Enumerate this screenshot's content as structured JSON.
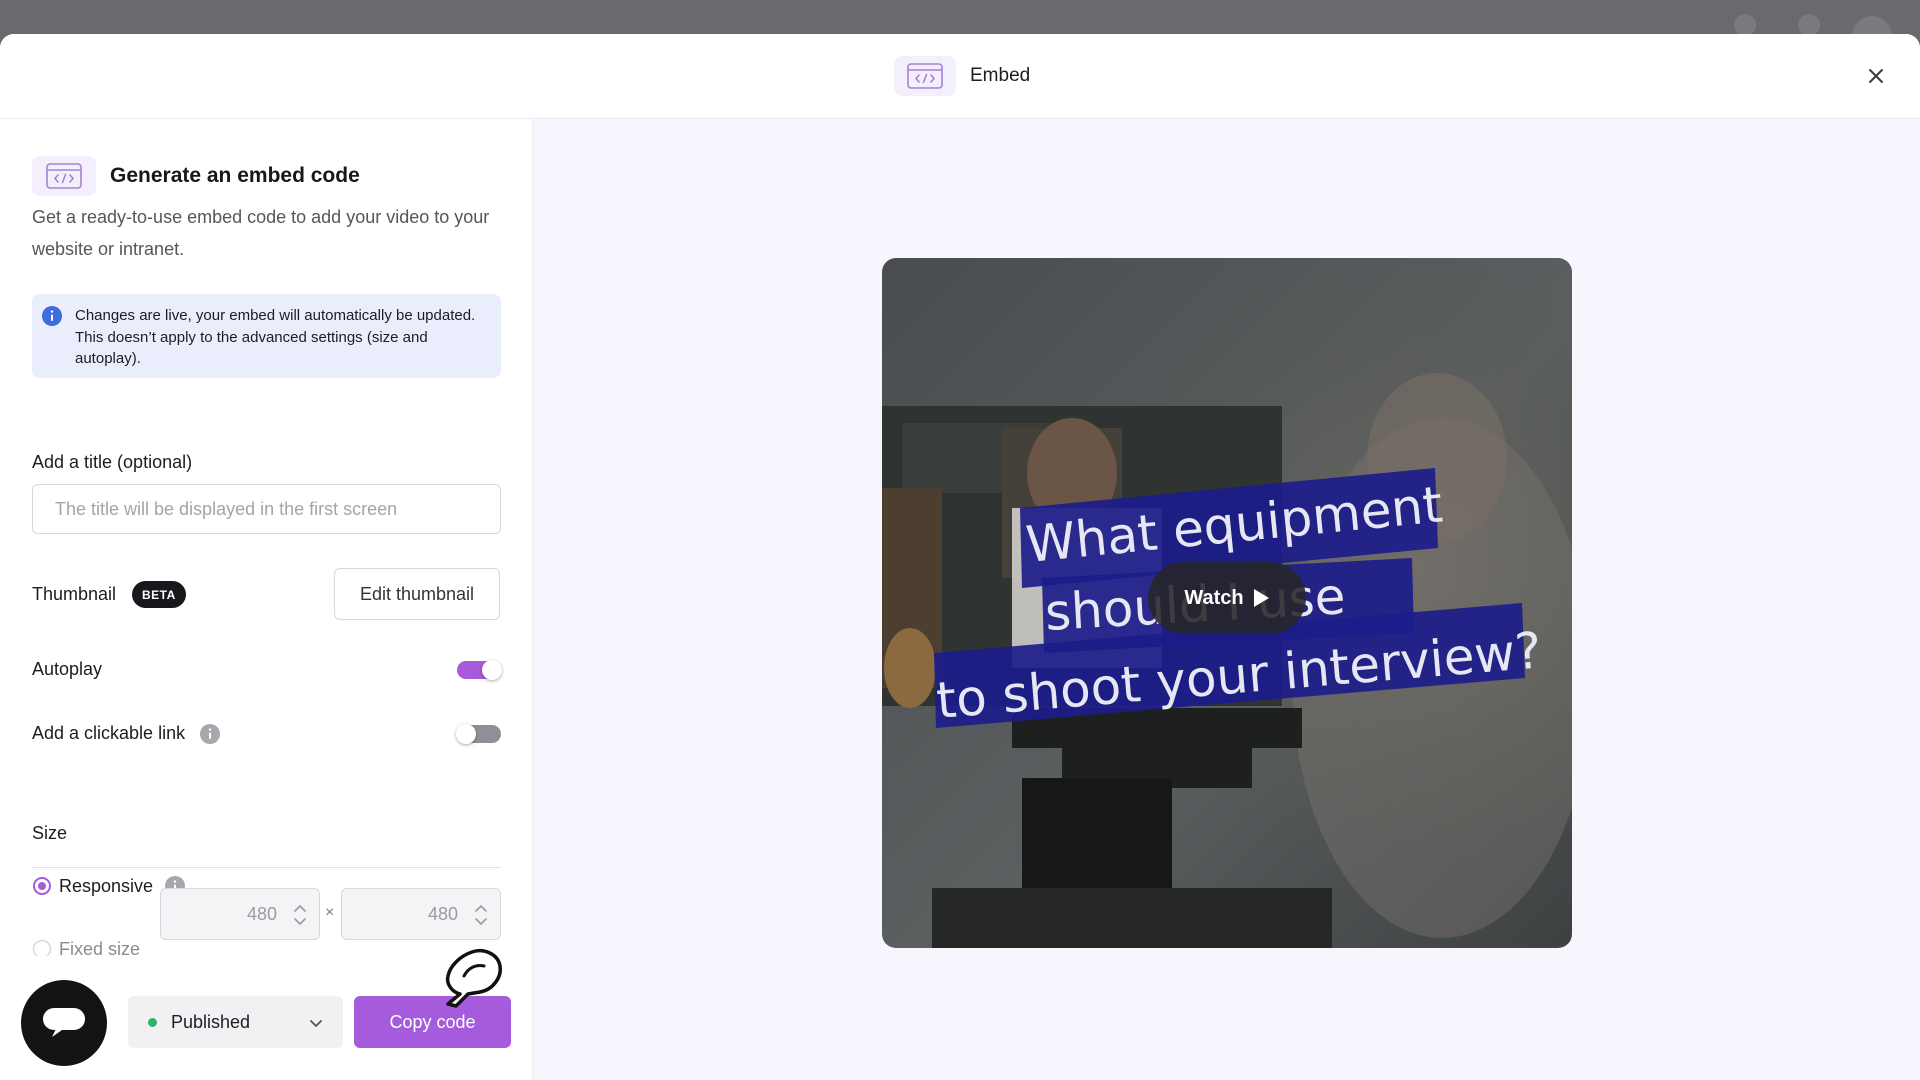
{
  "header": {
    "title": "Embed"
  },
  "left_panel": {
    "heading": "Generate an embed code",
    "description": "Get a ready-to-use embed code to add your video to your website or intranet.",
    "info_notice": "Changes are live, your embed will automatically be updated. This doesn’t apply to the advanced settings (size and autoplay).",
    "title_field": {
      "label": "Add a title (optional)",
      "value": "",
      "placeholder": "The title will be displayed in the first screen"
    },
    "thumbnail": {
      "label": "Thumbnail",
      "badge": "BETA",
      "button": "Edit thumbnail"
    },
    "autoplay": {
      "label": "Autoplay",
      "enabled": true
    },
    "clickable_link": {
      "label": "Add a clickable link",
      "enabled": false
    },
    "size": {
      "label": "Size",
      "options": [
        {
          "label": "Responsive",
          "selected": true
        },
        {
          "label": "Fixed size",
          "selected": false
        }
      ],
      "width": "480",
      "height": "480",
      "separator": "×"
    }
  },
  "bottom_bar": {
    "status": "Published",
    "status_color": "#2fb36b",
    "copy_button": "Copy code"
  },
  "preview": {
    "caption_lines": [
      "What equipment",
      "should I use",
      "to shoot your interview?"
    ],
    "watch_label": "Watch"
  },
  "colors": {
    "accent": "#a55bdc",
    "info_background": "#eaedfb",
    "preview_background": "#f7f6fe",
    "caption_background": "#1c1c8a"
  }
}
